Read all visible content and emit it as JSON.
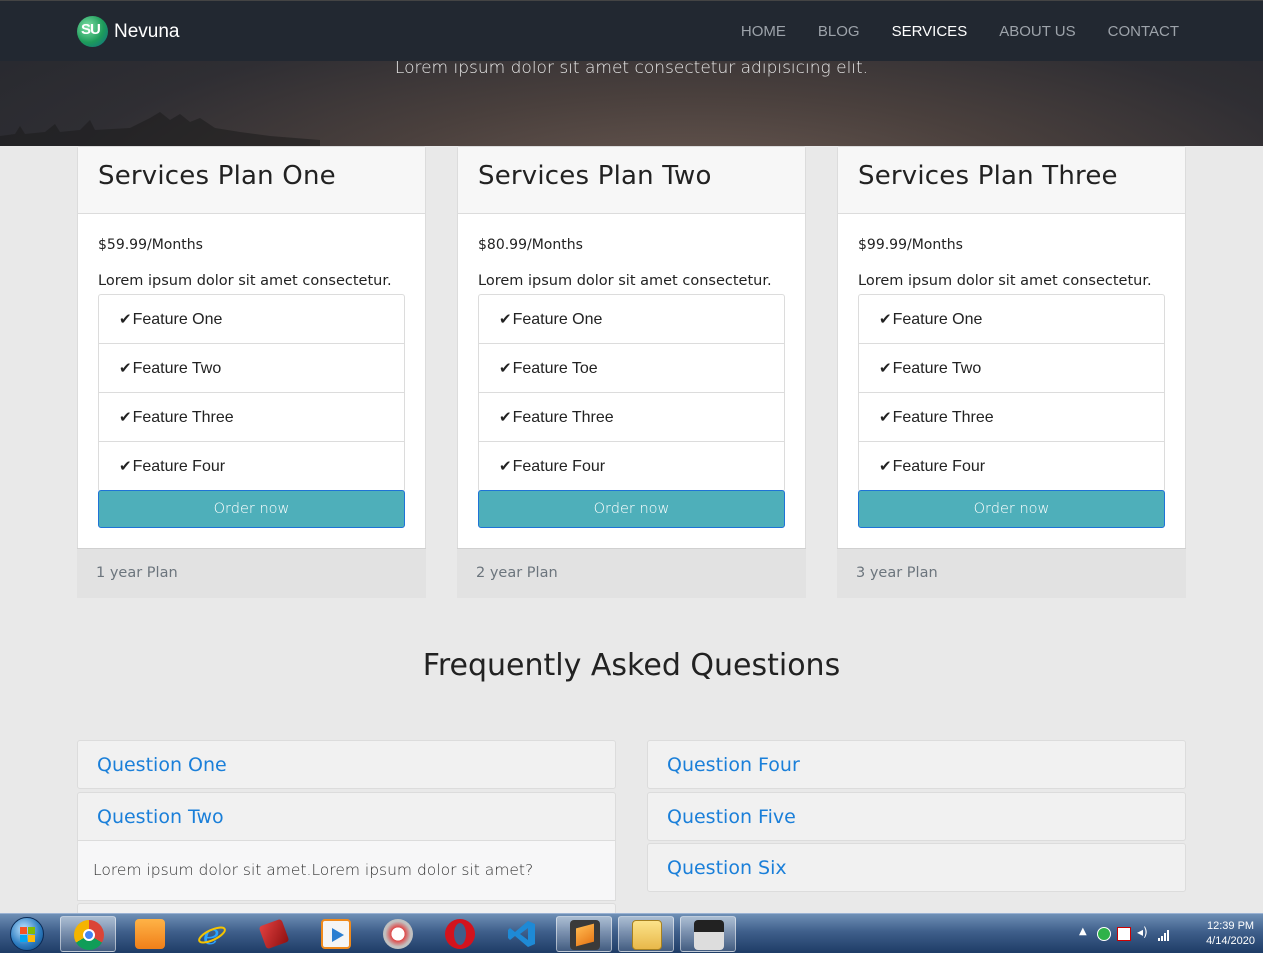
{
  "brand": {
    "logo_text": "SU",
    "name": "Nevuna"
  },
  "nav": [
    {
      "label": "HOME",
      "active": false
    },
    {
      "label": "BLOG",
      "active": false
    },
    {
      "label": "SERVICES",
      "active": true
    },
    {
      "label": "ABOUT US",
      "active": false
    },
    {
      "label": "CONTACT",
      "active": false
    }
  ],
  "hero": {
    "subtitle": "Lorem ipsum dolor sit amet consectetur adipisicing elit."
  },
  "plans": [
    {
      "title": "Services Plan One",
      "price": "$59.99/Months",
      "description": "Lorem ipsum dolor sit amet consectetur.",
      "features": [
        "Feature One",
        "Feature Two",
        "Feature Three",
        "Feature Four"
      ],
      "button": "Order now",
      "footer": "1 year Plan"
    },
    {
      "title": "Services Plan Two",
      "price": "$80.99/Months",
      "description": "Lorem ipsum dolor sit amet consectetur.",
      "features": [
        "Feature One",
        "Feature Toe",
        "Feature Three",
        "Feature Four"
      ],
      "button": "Order now",
      "footer": "2 year Plan"
    },
    {
      "title": "Services Plan Three",
      "price": "$99.99/Months",
      "description": "Lorem ipsum dolor sit amet consectetur.",
      "features": [
        "Feature One",
        "Feature Two",
        "Feature Three",
        "Feature Four"
      ],
      "button": "Order now",
      "footer": "3 year Plan"
    }
  ],
  "check_glyph": "✔",
  "faq": {
    "title": "Frequently Asked Questions",
    "left": [
      "Question One",
      "Question Two"
    ],
    "right": [
      "Question Four",
      "Question Five",
      "Question Six"
    ],
    "open_answer": "Lorem ipsum dolor sit amet.Lorem ipsum dolor sit amet?"
  },
  "taskbar": {
    "apps": [
      "chrome-icon",
      "uc-browser-icon",
      "internet-explorer-icon",
      "book-icon",
      "media-player-icon",
      "paint-icon",
      "opera-icon",
      "vscode-icon",
      "sublime-text-icon",
      "file-explorer-icon",
      "window-thumbnail-icon"
    ],
    "clock_time": "12:39 PM",
    "clock_date": "4/14/2020"
  },
  "colors": {
    "navbar": "#222831",
    "button": "#4eafba",
    "link": "#1a7fd9",
    "page_bg": "#e9e9e9"
  }
}
